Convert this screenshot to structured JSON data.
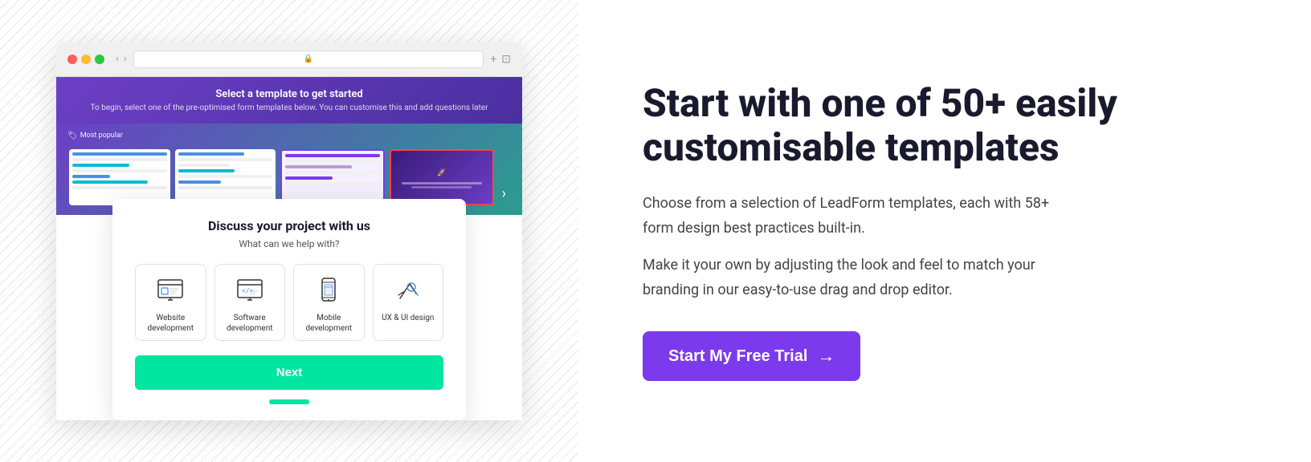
{
  "left": {
    "browser": {
      "template_header_title": "Select a template to get started",
      "template_header_subtitle": "To begin, select one of the pre-optimised form templates below. You can customise this and add questions later",
      "most_popular_label": "Most popular",
      "next_arrow": "›"
    },
    "dialog": {
      "title": "Discuss your project with us",
      "subtitle": "What can we help with?",
      "options": [
        {
          "label": "Website development"
        },
        {
          "label": "Software development"
        },
        {
          "label": "Mobile development"
        },
        {
          "label": "UX & UI design"
        }
      ],
      "next_button_label": "Next"
    }
  },
  "right": {
    "hero_title_line1": "Start with one of 50+ easily",
    "hero_title_line2": "customisable templates",
    "description1": "Choose from a selection of LeadForm templates, each with 58+",
    "description1b": "form design best practices built-in.",
    "description2": "Make it your own by adjusting the look and feel to match your",
    "description2b": "branding in our easy-to-use drag and drop editor.",
    "cta_label": "Start My Free Trial",
    "cta_arrow": "→"
  },
  "colors": {
    "accent_purple": "#7c3aed",
    "accent_green": "#00e5a0",
    "dark": "#1a1a2e"
  }
}
